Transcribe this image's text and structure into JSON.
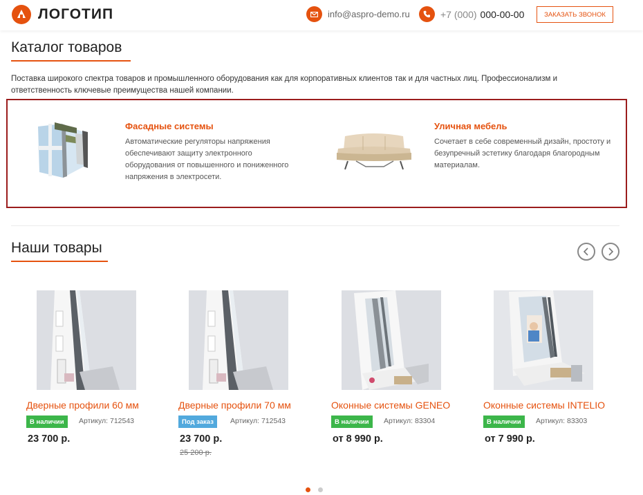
{
  "header": {
    "logo_text": "ЛОГОТИП",
    "email": "info@aspro-demo.ru",
    "phone_code": "+7 (000)",
    "phone_number": "000-00-00",
    "callback_label": "Заказать звонок"
  },
  "catalog": {
    "title": "Каталог товаров",
    "description": "Поставка широкого спектра товаров и промышленного оборудования как для корпоративных клиентов так и для частных лиц. Профессионализм и ответственность ключевые преимущества нашей компании.",
    "featured": [
      {
        "title": "Фасадные системы",
        "description": "Автоматические регуляторы напряжения обеспечивают защиту электронного оборудования от повышенного и пониженного напряжения в электросети."
      },
      {
        "title": "Уличная мебель",
        "description": "Сочетает в себе современный дизайн, простоту и безупречный эстетику благодаря благородным материалам."
      }
    ]
  },
  "goods": {
    "title": "Наши товары",
    "products": [
      {
        "name": "Дверные профили 60 мм",
        "status": "В наличии",
        "sku": "Артикул: 712543",
        "price": "23 700 р.",
        "old_price": ""
      },
      {
        "name": "Дверные профили 70 мм",
        "status": "Под заказ",
        "sku": "Артикул: 712543",
        "price": "23 700 р.",
        "old_price": "25 200 р."
      },
      {
        "name": "Оконные системы GENEO",
        "status": "В наличии",
        "sku": "Артикул: 83304",
        "price": "от 8 990 р.",
        "old_price": ""
      },
      {
        "name": "Оконные системы INTELIO",
        "status": "В наличии",
        "sku": "Артикул: 83303",
        "price": "от 7 990 р.",
        "old_price": ""
      }
    ]
  },
  "colors": {
    "accent": "#e5520f",
    "highlight_border": "#9b1c1c",
    "in_stock": "#3cb64a",
    "on_order": "#52a9dd"
  }
}
